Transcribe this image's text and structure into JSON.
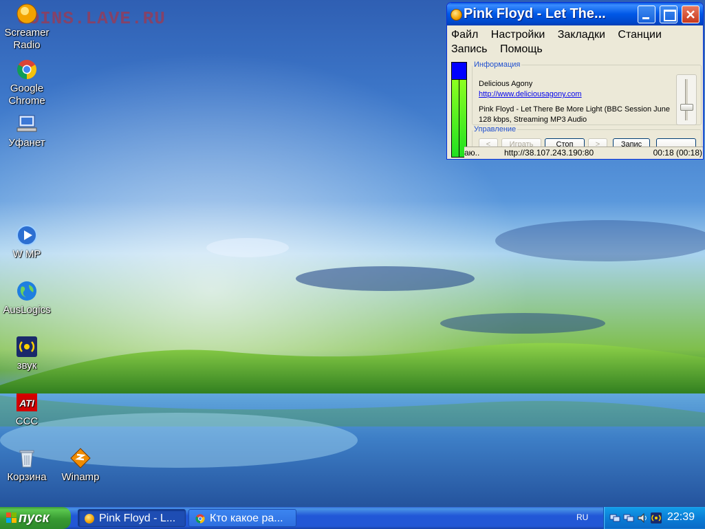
{
  "watermark": "COINS.LAVE.RU",
  "desktop_icons": [
    {
      "label": "Screamer Radio",
      "line1": "Screamer",
      "line2": "Radio",
      "icon": "screamer-radio-icon"
    },
    {
      "label": "Google Chrome",
      "line1": "Google",
      "line2": "Chrome",
      "icon": "chrome-icon"
    },
    {
      "label": "Уфанет",
      "line1": "Уфанет",
      "line2": "",
      "icon": "network-icon"
    },
    {
      "label": "W MP",
      "line1": "W MP",
      "line2": "",
      "icon": "media-player-icon"
    },
    {
      "label": "AusLogics",
      "line1": "AusLogics",
      "line2": "",
      "icon": "globe-icon"
    },
    {
      "label": "звук",
      "line1": "звук",
      "line2": "",
      "icon": "speaker-icon"
    },
    {
      "label": "CCC",
      "line1": "CCC",
      "line2": "",
      "icon": "ati-icon"
    },
    {
      "label": "Корзина",
      "line1": "Корзина",
      "line2": "",
      "icon": "recycle-bin-icon"
    },
    {
      "label": "Winamp",
      "line1": "Winamp",
      "line2": "",
      "icon": "winamp-icon"
    }
  ],
  "window": {
    "title": "Pink Floyd - Let The...",
    "menu": [
      "Файл",
      "Настройки",
      "Закладки",
      "Станции",
      "Запись",
      "Помощь"
    ],
    "info_legend": "Информация",
    "station_name": "Delicious Agony",
    "station_url": "http://www.deliciousagony.com",
    "track": "Pink Floyd - Let There Be More Light (BBC Session June",
    "stream_info": "128 kbps, Streaming MP3 Audio",
    "control_legend": "Управление",
    "buttons": {
      "prev": "<",
      "play": "Играть",
      "stop": "Стоп",
      "next": ">",
      "record": "Запис",
      "extra": ""
    },
    "status": {
      "state": "аю..",
      "address": "http://38.107.243.190:80",
      "time": "00:18 (00:18)"
    },
    "volume_level": 0.7
  },
  "taskbar": {
    "start_label": "пуск",
    "tasks": [
      {
        "label": "Pink Floyd - L...",
        "icon": "screamer-radio-icon"
      },
      {
        "label": "Кто какое ра...",
        "icon": "chrome-icon"
      }
    ],
    "language": "RU",
    "clock": "22:39"
  }
}
